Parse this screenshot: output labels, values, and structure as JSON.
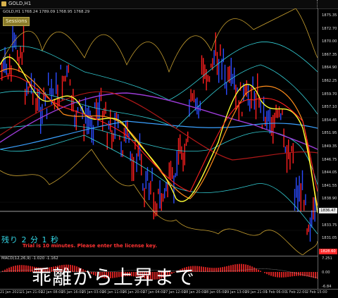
{
  "window": {
    "title": "GOLD,H1"
  },
  "ohlc_text": "GOLD,H1  1768.24  1789.09  1768.95  1768.29",
  "sessions_label": "Sessions",
  "price_ticks": [
    "1875.35",
    "1872.70",
    "1870.00",
    "1867.35",
    "1864.90",
    "1862.25",
    "1859.70",
    "1857.10",
    "1854.45",
    "1851.95",
    "1849.35",
    "1846.75",
    "1844.05",
    "1841.55",
    "1838.90",
    "1836.47",
    "1833.75",
    "1831.05",
    "1828.60"
  ],
  "current_price": "1836.47",
  "low_marker": "1828.60",
  "countdown_text": "残り 2 分 1 秒",
  "trial_notice": "Trial is 10 minutes. Please enter the license key.",
  "macd": {
    "label": "MACD(12,26,9) -1.020 -1.162",
    "ticks": [
      "7.251",
      "0.00",
      "-6.84"
    ]
  },
  "caption": "乖離から上昇まで",
  "time_labels": [
    "21 Jan 2021",
    "21 Jan 21:00",
    "22 Jan 08:00",
    "25 Jan 16:00",
    "25 Jan 03:00",
    "26 Jan 11:00",
    "26 Jan 20:00",
    "27 Jan 04:00",
    "27 Jan 12:00",
    "28 Jan 20:00",
    "28 Jan 05:00",
    "29 Jan 13:00",
    "29 Jan 21:00",
    "1 Feb 06:00",
    "1 Feb 22:00",
    "2 Feb 15:00"
  ],
  "colors": {
    "bull": "#2b4bff",
    "bear": "#ff1f1f",
    "ma_yellow": "#ffff33",
    "band_orange": "#ff8c1a",
    "band_cyan": "#33cfd6",
    "band_gold": "#c8a030",
    "ma_purple": "#9b3bd6",
    "ma_blue": "#3aa0ff",
    "macd_red": "#cc2020"
  }
}
